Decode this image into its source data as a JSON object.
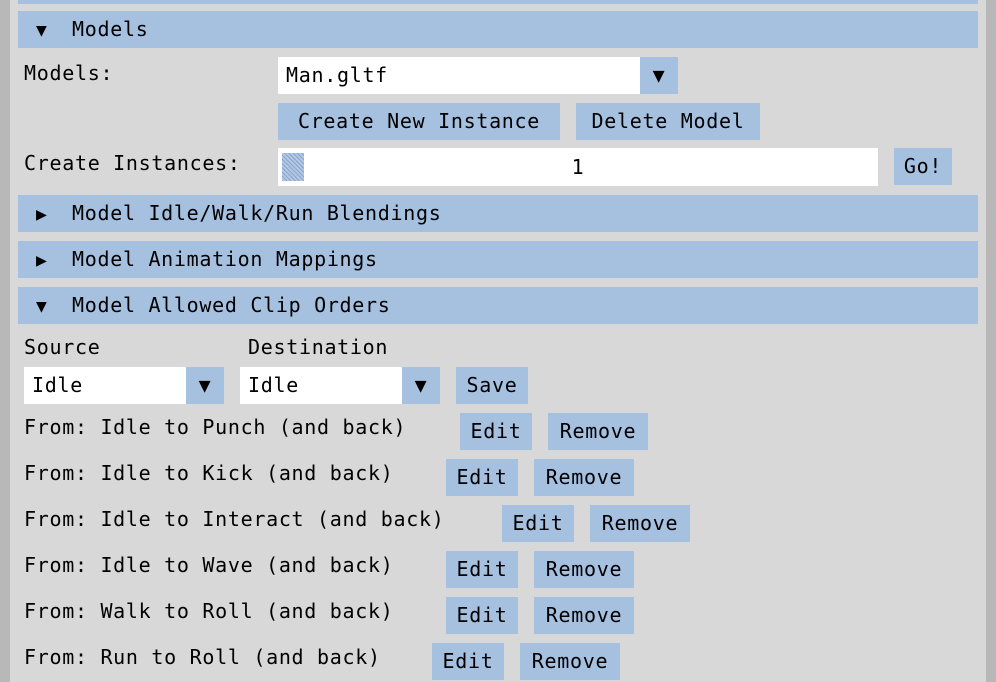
{
  "colors": {
    "accent": "#a6c0e0",
    "background": "#d8d8d8",
    "field": "#ffffff"
  },
  "models_section": {
    "header": "Models",
    "header_arrow": "▼",
    "models_label": "Models:",
    "selected_model": "Man.gltf",
    "create_instance_button": "Create New Instance",
    "delete_model_button": "Delete Model",
    "create_instances_label": "Create Instances:",
    "instances_value": "1",
    "go_button": "Go!"
  },
  "collapsed_sections": [
    {
      "arrow": "▶",
      "title": "Model Idle/Walk/Run Blendings"
    },
    {
      "arrow": "▶",
      "title": "Model Animation Mappings"
    }
  ],
  "clip_orders": {
    "arrow": "▼",
    "title": "Model Allowed Clip Orders",
    "source_label": "Source",
    "destination_label": "Destination",
    "source_value": "Idle",
    "destination_value": "Idle",
    "save_button": "Save",
    "dropdown_icon": "▼",
    "rows": [
      {
        "text": "From: Idle to Punch (and back)",
        "edit": "Edit",
        "remove": "Remove"
      },
      {
        "text": "From: Idle to Kick (and back)",
        "edit": "Edit",
        "remove": "Remove"
      },
      {
        "text": "From: Idle to Interact (and back)",
        "edit": "Edit",
        "remove": "Remove"
      },
      {
        "text": "From: Idle to Wave (and back)",
        "edit": "Edit",
        "remove": "Remove"
      },
      {
        "text": "From: Walk to Roll (and back)",
        "edit": "Edit",
        "remove": "Remove"
      },
      {
        "text": "From: Run to Roll (and back)",
        "edit": "Edit",
        "remove": "Remove"
      }
    ]
  }
}
